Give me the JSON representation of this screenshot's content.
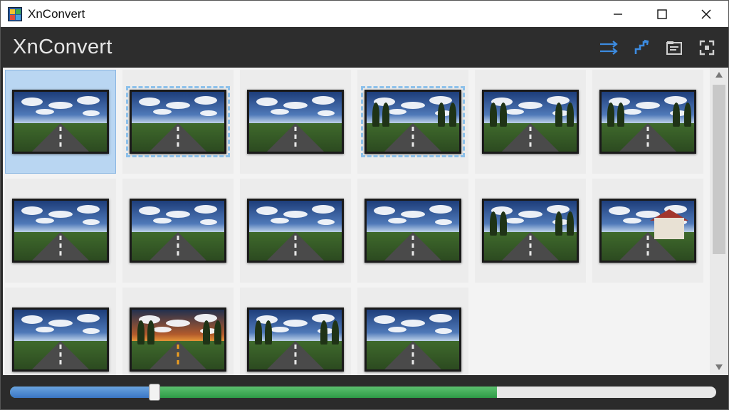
{
  "window": {
    "title": "XnConvert",
    "controls": {
      "minimize": "minimize-icon",
      "maximize": "maximize-icon",
      "close": "close-icon"
    }
  },
  "header": {
    "title": "XnConvert",
    "toolbar": [
      {
        "name": "transfer-arrows-icon"
      },
      {
        "name": "resize-diagonal-icon"
      },
      {
        "name": "folder-settings-icon"
      },
      {
        "name": "fullscreen-icon"
      }
    ],
    "accent": "#3c8be0"
  },
  "thumbnails": [
    {
      "style": "road",
      "selected": true,
      "marked": false
    },
    {
      "style": "road",
      "selected": false,
      "marked": true
    },
    {
      "style": "road",
      "selected": false,
      "marked": false
    },
    {
      "style": "trees",
      "selected": false,
      "marked": true
    },
    {
      "style": "trees",
      "selected": false,
      "marked": false
    },
    {
      "style": "trees",
      "selected": false,
      "marked": false
    },
    {
      "style": "road",
      "selected": false,
      "marked": false
    },
    {
      "style": "road",
      "selected": false,
      "marked": false
    },
    {
      "style": "road",
      "selected": false,
      "marked": false
    },
    {
      "style": "road",
      "selected": false,
      "marked": false
    },
    {
      "style": "trees",
      "selected": false,
      "marked": false
    },
    {
      "style": "house",
      "selected": false,
      "marked": false
    },
    {
      "style": "road",
      "selected": false,
      "marked": false
    },
    {
      "style": "sunset",
      "selected": false,
      "marked": false
    },
    {
      "style": "trees",
      "selected": false,
      "marked": false
    },
    {
      "style": "road",
      "selected": false,
      "marked": false
    }
  ],
  "progress": {
    "blue_fraction": 0.205,
    "green_fraction": 0.69,
    "blue_color": "#3a76c4",
    "green_color": "#2e9b46"
  }
}
